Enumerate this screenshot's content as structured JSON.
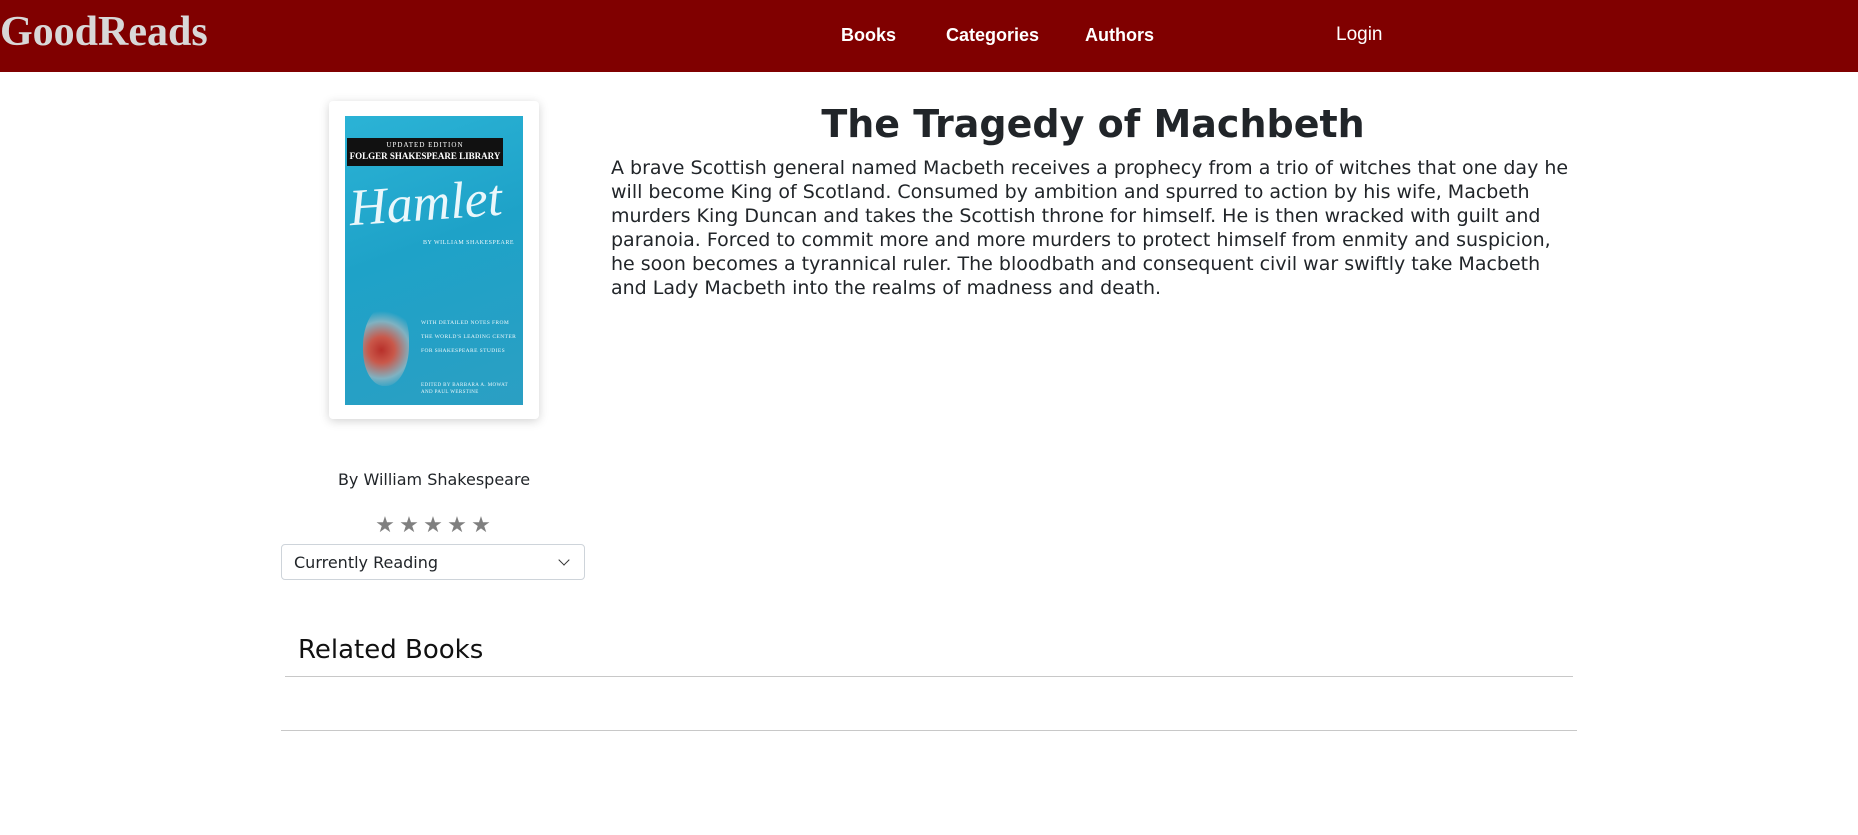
{
  "navbar": {
    "brand": "GoodReads",
    "links": [
      {
        "label": "Books"
      },
      {
        "label": "Categories"
      },
      {
        "label": "Authors"
      }
    ],
    "login": "Login",
    "background_color": "#800000"
  },
  "book": {
    "title": "The Tragedy of Machbeth",
    "description": "A brave Scottish general named Macbeth receives a prophecy from a trio of witches that one day he will become King of Scotland. Consumed by ambition and spurred to action by his wife, Macbeth murders King Duncan and takes the Scottish throne for himself. He is then wracked with guilt and paranoia. Forced to commit more and more murders to protect himself from enmity and suspicion, he soon becomes a tyrannical ruler. The bloodbath and consequent civil war swiftly take Macbeth and Lady Macbeth into the realms of madness and death.",
    "author_line": "By William Shakespeare",
    "rating": {
      "filled": 0,
      "max": 5,
      "symbol": "★"
    },
    "shelf_status": "Currently Reading",
    "cover": {
      "edition": "UPDATED EDITION",
      "library": "FOLGER SHAKESPEARE LIBRARY",
      "title": "Hamlet",
      "by": "BY WILLIAM SHAKESPEARE",
      "notes": "WITH DETAILED NOTES FROM THE WORLD'S LEADING CENTER FOR SHAKESPEARE STUDIES",
      "editors": "EDITED BY BARBARA A. MOWAT AND PAUL WERSTINE"
    }
  },
  "related": {
    "heading": "Related Books",
    "items": []
  }
}
